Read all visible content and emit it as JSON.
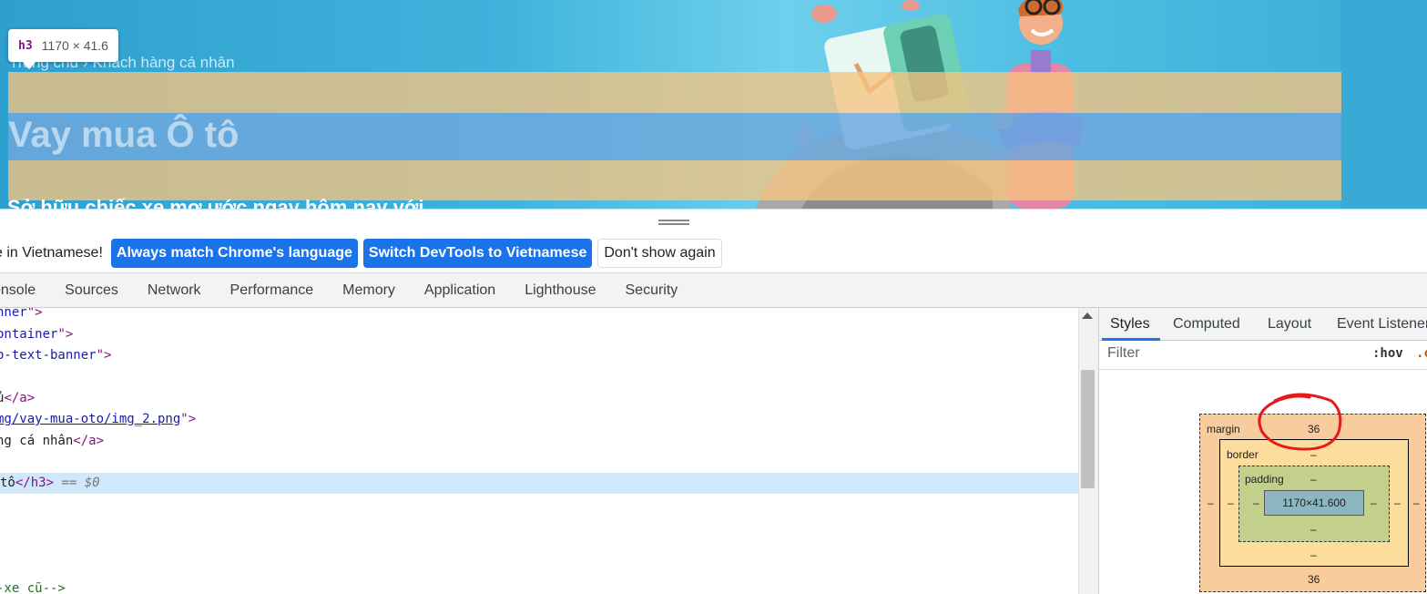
{
  "banner": {
    "breadcrumb": {
      "home": "Trang chủ",
      "separator": "›",
      "current": "Khách hàng cá nhân"
    },
    "title": "Vay mua Ô tô",
    "subtitle_cut": "Sở hữu chiếc xe mơ ước ngay hôm nay với",
    "tooltip": {
      "tag": "h3",
      "dimensions": "1170 × 41.6"
    }
  },
  "infobar": {
    "message": "DevTools is now available in Vietnamese!",
    "visible_message": "e in Vietnamese!",
    "buttons": {
      "always_match": "Always match Chrome's language",
      "switch": "Switch DevTools to Vietnamese",
      "dont_show": "Don't show again"
    }
  },
  "tabs": [
    "onsole",
    "Sources",
    "Network",
    "Performance",
    "Memory",
    "Application",
    "Lighthouse",
    "Security"
  ],
  "elements": {
    "line1": {
      "attr_tail": "nner",
      "close": "\">"
    },
    "line2": {
      "attr_tail": "ontainer",
      "close": "\">"
    },
    "line3": {
      "attr_tail": "o-text-banner",
      "close": "\">"
    },
    "line4": {
      "text": "ủ",
      "close_tag": "</a>"
    },
    "line5": {
      "link": "mg/vay-mua-oto/img_2.png",
      "close": "\">"
    },
    "line6": {
      "text": "ng cá nhân",
      "close_tag": "</a>"
    },
    "line7": {
      "text": " tô",
      "close_tag": "</h3>",
      "marker": "== $0"
    },
    "line8": {
      "comment": "-xe cũ-->"
    }
  },
  "sidebar": {
    "tabs": [
      "Styles",
      "Computed",
      "Layout",
      "Event Listeners"
    ],
    "active_tab": "Styles",
    "filter_placeholder": "Filter",
    "hov": ":hov",
    "cls": ".cls",
    "box_model": {
      "margin_label": "margin",
      "margin_top": "36",
      "margin_bottom": "36",
      "margin_left": "–",
      "margin_right": "–",
      "border_label": "border",
      "border_top": "–",
      "border_bottom": "–",
      "border_left": "–",
      "border_right": "–",
      "padding_label": "padding",
      "padding_top": "–",
      "padding_bottom": "–",
      "padding_left": "–",
      "padding_right": "–",
      "content": "1170×41.600"
    }
  },
  "colors": {
    "accent": "#1a73e8",
    "margin_box": "#f9cc9d",
    "border_box": "#fddd9b",
    "padding_box": "#c3d08b",
    "content_box": "#8cb6c0",
    "annotation": "#e31b1b"
  }
}
